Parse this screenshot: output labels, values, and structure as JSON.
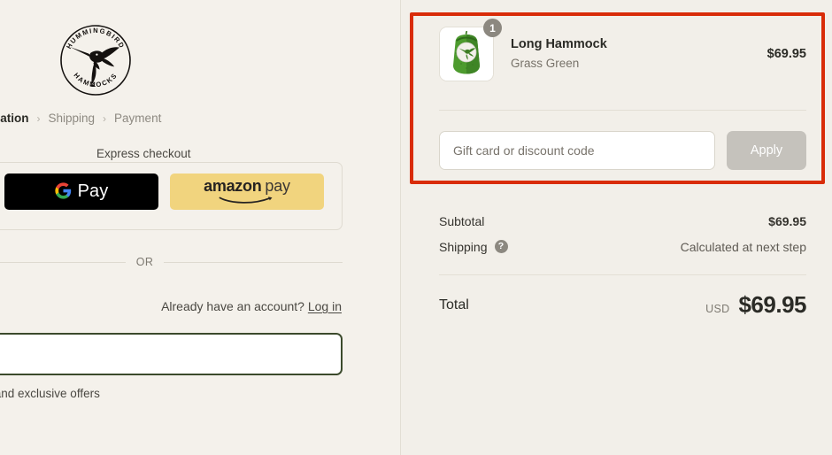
{
  "brand": {
    "name_top": "HUMMINGBIRD",
    "name_bottom": "HAMMOCKS",
    "logo_icon": "hummingbird-logo"
  },
  "breadcrumb": {
    "steps": [
      {
        "label": "nformation",
        "active": true
      },
      {
        "label": "Shipping",
        "active": false
      },
      {
        "label": "Payment",
        "active": false
      }
    ],
    "separator": "›"
  },
  "express": {
    "legend": "Express checkout",
    "buttons": [
      {
        "name": "shop-pay",
        "label": "",
        "color": "#5433eb"
      },
      {
        "name": "google-pay",
        "label": "Pay",
        "color": "#000000"
      },
      {
        "name": "amazon-pay",
        "label_bold": "amazon",
        "label_light": "pay",
        "color": "#f1d47e"
      }
    ]
  },
  "divider": {
    "or_text": "OR"
  },
  "account": {
    "prompt": "Already have an account?",
    "login_label": "Log in"
  },
  "email": {
    "value": "",
    "placeholder": ""
  },
  "consent": {
    "label": "ews and exclusive offers",
    "checked": false
  },
  "cart": {
    "items": [
      {
        "title": "Long Hammock",
        "variant": "Grass Green",
        "price": "$69.95",
        "quantity": "1",
        "image_icon": "green-stuff-sack-product-image"
      }
    ]
  },
  "discount": {
    "placeholder": "Gift card or discount code",
    "value": "",
    "apply_label": "Apply"
  },
  "summary": {
    "lines": [
      {
        "label": "Subtotal",
        "value": "$69.95",
        "has_help": false
      },
      {
        "label": "Shipping",
        "value": "Calculated at next step",
        "has_help": true
      }
    ],
    "total_label": "Total",
    "currency": "USD",
    "total_amount": "$69.95"
  },
  "annotation": {
    "color": "#d92c09"
  }
}
